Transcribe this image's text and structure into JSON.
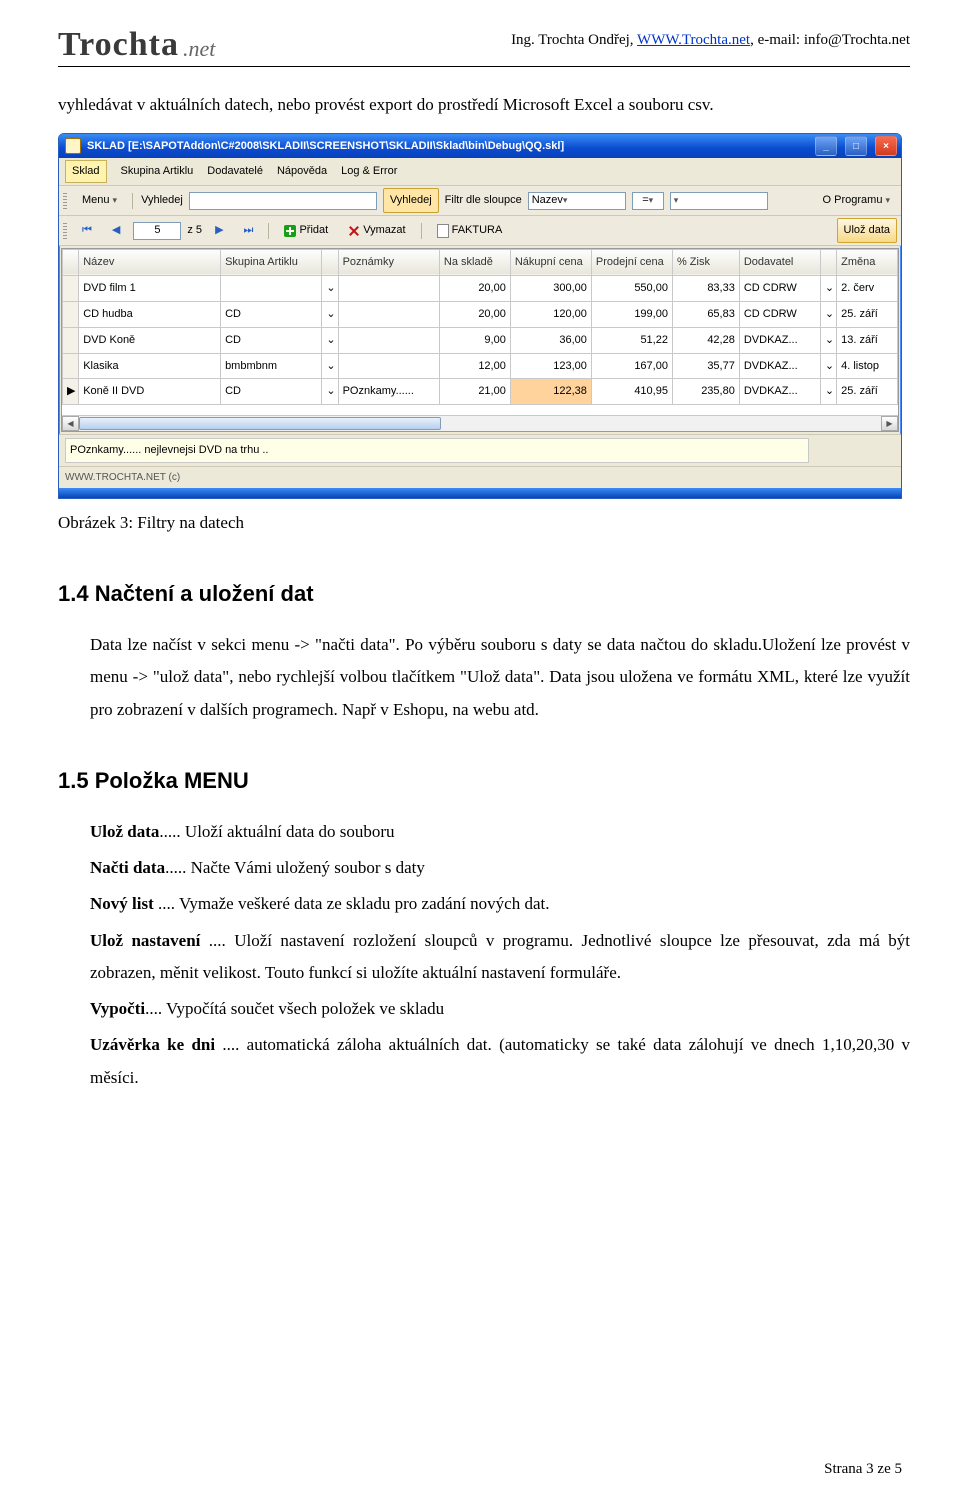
{
  "header": {
    "logo_main": "Trochta",
    "logo_suffix": ".net",
    "right": {
      "prefix": "Ing. Trochta Ondřej, ",
      "link_text": "WWW.Trochta.net",
      "link_suffix": ",  e-mail: info@Trochta.net"
    }
  },
  "intro_text": "vyhledávat v aktuálních datech, nebo provést export do prostředí Microsoft Excel      a souboru csv.",
  "screenshot": {
    "window_title": "SKLAD [E:\\SAPOTAddon\\C#2008\\SKLADII\\SCREENSHOT\\SKLADII\\Sklad\\bin\\Debug\\QQ.skl]",
    "win_buttons": {
      "min": "_",
      "max": "□",
      "close": "×"
    },
    "menubar": {
      "items": [
        "Sklad",
        "Skupina Artiklu",
        "Dodavatelé",
        "Nápověda",
        "Log & Error"
      ],
      "active_index": 0
    },
    "toolbar1": {
      "menu_btn": "Menu",
      "vyhledej_label": "Vyhledej",
      "vyhledej_btn": "Vyhledej",
      "filtr_label": "Filtr dle sloupce",
      "filtr_col": "Nazev",
      "filtr_op": "=",
      "o_programu": "O Programu"
    },
    "toolbar2": {
      "page_current": "5",
      "page_total_label": "z 5",
      "pridat": "Přidat",
      "vymazat": "Vymazat",
      "faktura": "FAKTURA",
      "uloz": "Ulož data"
    },
    "grid": {
      "columns": [
        "",
        "Název",
        "Skupina Artiklu",
        "",
        "Poznámky",
        "Na skladě",
        "Nákupní cena",
        "Prodejní cena",
        "% Zisk",
        "Dodavatel",
        "",
        "Změna"
      ],
      "rows": [
        {
          "cells": [
            "",
            "DVD film 1",
            "",
            "⌄",
            "",
            "20,00",
            "300,00",
            "550,00",
            "83,33",
            "CD CDRW",
            "⌄",
            "2. červ"
          ]
        },
        {
          "cells": [
            "",
            "CD hudba",
            "CD",
            "⌄",
            "",
            "20,00",
            "120,00",
            "199,00",
            "65,83",
            "CD CDRW",
            "⌄",
            "25. září"
          ]
        },
        {
          "cells": [
            "",
            "DVD Koně",
            "CD",
            "⌄",
            "",
            "9,00",
            "36,00",
            "51,22",
            "42,28",
            "DVDKAZ...",
            "⌄",
            "13. září"
          ]
        },
        {
          "cells": [
            "",
            "Klasika",
            "bmbmbnm",
            "⌄",
            "",
            "12,00",
            "123,00",
            "167,00",
            "35,77",
            "DVDKAZ...",
            "⌄",
            "4. listop"
          ]
        },
        {
          "cells": [
            "▶",
            "Koně II DVD",
            "CD",
            "⌄",
            "POznkamy......",
            "21,00",
            "122,38",
            "410,95",
            "235,80",
            "DVDKAZ...",
            "⌄",
            "25. září"
          ],
          "highlight_col": 6
        }
      ]
    },
    "statusbar_text": "POznkamy...... nejlevnejsi DVD na trhu ..",
    "footer_credit": "WWW.TROCHTA.NET (c)"
  },
  "caption": "Obrázek 3: Filtry na datech",
  "sec14": {
    "title": "1.4  Načtení a uložení dat",
    "para": "Data lze načíst v sekci menu -> \"načti data\". Po výběru souboru s daty se data načtou do skladu.Uložení lze provést v menu -> \"ulož data\", nebo rychlejší volbou  tlačítkem \"Ulož data\". Data jsou uložena ve formátu XML, které lze využít pro zobrazení v dalších programech. Např v Eshopu, na webu atd."
  },
  "sec15": {
    "title": "1.5  Položka MENU",
    "items": [
      {
        "b": "Ulož data",
        "t": "..... Uloží aktuální data do souboru"
      },
      {
        "b": "Načti data",
        "t": "..... Načte Vámi uložený soubor s daty"
      },
      {
        "b": "Nový list",
        "t": " .... Vymaže veškeré data ze skladu pro zadání nových dat."
      },
      {
        "b": "Ulož nastavení",
        "t": " .... Uloží nastavení rozložení sloupců v programu. Jednotlivé sloupce lze přesouvat, zda má být zobrazen, měnit velikost. Touto funkcí si uložíte aktuální nastavení formuláře."
      },
      {
        "b": "Vypočti",
        "t": ".... Vypočítá součet všech položek ve skladu"
      },
      {
        "b": "Uzávěrka ke dni",
        "t": " .... automatická záloha aktuálních dat. (automaticky se také data zálohují ve dnech 1,10,20,30 v měsíci."
      }
    ]
  },
  "page_footer": "Strana 3 ze 5"
}
